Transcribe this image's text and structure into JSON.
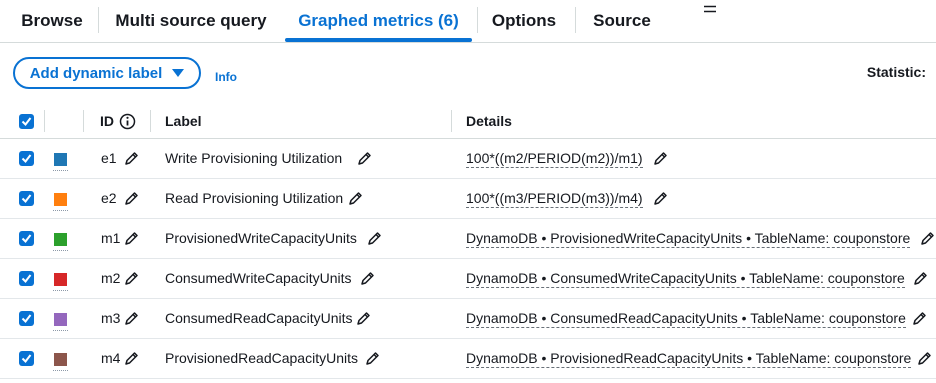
{
  "tabs": [
    {
      "label": "Browse",
      "active": false
    },
    {
      "label": "Multi source query",
      "active": false
    },
    {
      "label": "Graphed metrics (6)",
      "active": true
    },
    {
      "label": "Options",
      "active": false
    },
    {
      "label": "Source",
      "active": false
    }
  ],
  "toolbar": {
    "dynamic_label_button": "Add dynamic label",
    "info_link": "Info",
    "statistic_label": "Statistic:"
  },
  "table": {
    "headers": {
      "id": "ID",
      "label": "Label",
      "details": "Details"
    },
    "rows": [
      {
        "id": "e1",
        "label": "Write Provisioning Utilization",
        "details": "100*((m2/PERIOD(m2))/m1)",
        "color": "#1f77b4",
        "checked": true
      },
      {
        "id": "e2",
        "label": "Read Provisioning Utilization",
        "details": "100*((m3/PERIOD(m3))/m4)",
        "color": "#ff7f0e",
        "checked": true
      },
      {
        "id": "m1",
        "label": "ProvisionedWriteCapacityUnits",
        "details": "DynamoDB • ProvisionedWriteCapacityUnits • TableName: couponstore",
        "color": "#2ca02c",
        "checked": true
      },
      {
        "id": "m2",
        "label": "ConsumedWriteCapacityUnits",
        "details": "DynamoDB • ConsumedWriteCapacityUnits • TableName: couponstore",
        "color": "#d62728",
        "checked": true
      },
      {
        "id": "m3",
        "label": "ConsumedReadCapacityUnits",
        "details": "DynamoDB • ConsumedReadCapacityUnits • TableName: couponstore",
        "color": "#9467bd",
        "checked": true
      },
      {
        "id": "m4",
        "label": "ProvisionedReadCapacityUnits",
        "details": "DynamoDB • ProvisionedReadCapacityUnits • TableName: couponstore",
        "color": "#8c564b",
        "checked": true
      }
    ]
  },
  "colors": {
    "accent": "#0972d3"
  }
}
